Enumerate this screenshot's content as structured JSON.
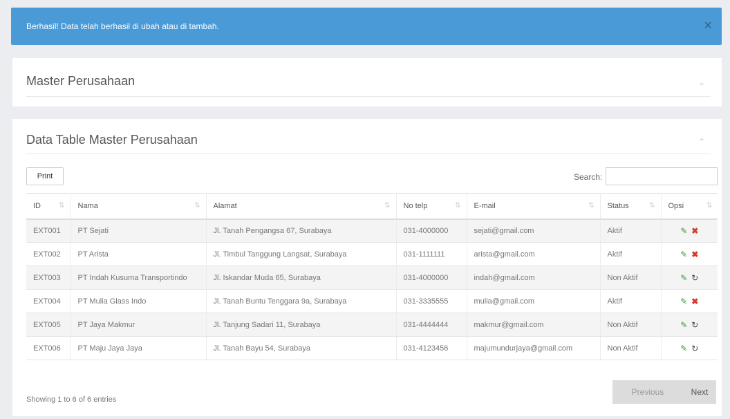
{
  "alert": {
    "message": "Berhasil! Data telah berhasil di ubah atau di tambah.",
    "close_icon": "×"
  },
  "panel_master": {
    "title": "Master Perusahaan",
    "chevron": "⌄"
  },
  "panel_table": {
    "title": "Data Table Master Perusahaan",
    "chevron": "⌃",
    "print_label": "Print",
    "search_label": "Search:",
    "search_value": "",
    "columns": [
      "ID",
      "Nama",
      "Alamat",
      "No telp",
      "E-mail",
      "Status",
      "Opsi"
    ],
    "rows": [
      {
        "id": "EXT001",
        "nama": "PT Sejati",
        "alamat": "Jl. Tanah Pengangsa 67, Surabaya",
        "telp": "031-4000000",
        "email": "sejati@gmail.com",
        "status": "Aktif",
        "action": "delete"
      },
      {
        "id": "EXT002",
        "nama": "PT Arista",
        "alamat": "Jl. Timbul Tanggung Langsat, Surabaya",
        "telp": "031-1111111",
        "email": "arista@gmail.com",
        "status": "Aktif",
        "action": "delete"
      },
      {
        "id": "EXT003",
        "nama": "PT Indah Kusuma Transportindo",
        "alamat": "Jl. Iskandar Muda 65, Surabaya",
        "telp": "031-4000000",
        "email": "indah@gmail.com",
        "status": "Non Aktif",
        "action": "restore"
      },
      {
        "id": "EXT004",
        "nama": "PT Mulia Glass Indo",
        "alamat": "Jl. Tanah Buntu Tenggara 9a, Surabaya",
        "telp": "031-3335555",
        "email": "mulia@gmail.com",
        "status": "Aktif",
        "action": "delete"
      },
      {
        "id": "EXT005",
        "nama": "PT Jaya Makmur",
        "alamat": "Jl. Tanjung Sadari 11, Surabaya",
        "telp": "031-4444444",
        "email": "makmur@gmail.com",
        "status": "Non Aktif",
        "action": "restore"
      },
      {
        "id": "EXT006",
        "nama": "PT Maju Jaya Jaya",
        "alamat": "Jl. Tanah Bayu 54, Surabaya",
        "telp": "031-4123456",
        "email": "majumundurjaya@gmail.com",
        "status": "Non Aktif",
        "action": "restore"
      }
    ],
    "info": "Showing 1 to 6 of 6 entries",
    "prev_label": "Previous",
    "next_label": "Next"
  },
  "icons": {
    "edit": "✎",
    "delete": "✖",
    "restore": "↻",
    "sort": "⇅"
  },
  "colors": {
    "alert_bg": "#4a9ad8",
    "edit": "#3c9a3c",
    "delete": "#d33b2f"
  }
}
